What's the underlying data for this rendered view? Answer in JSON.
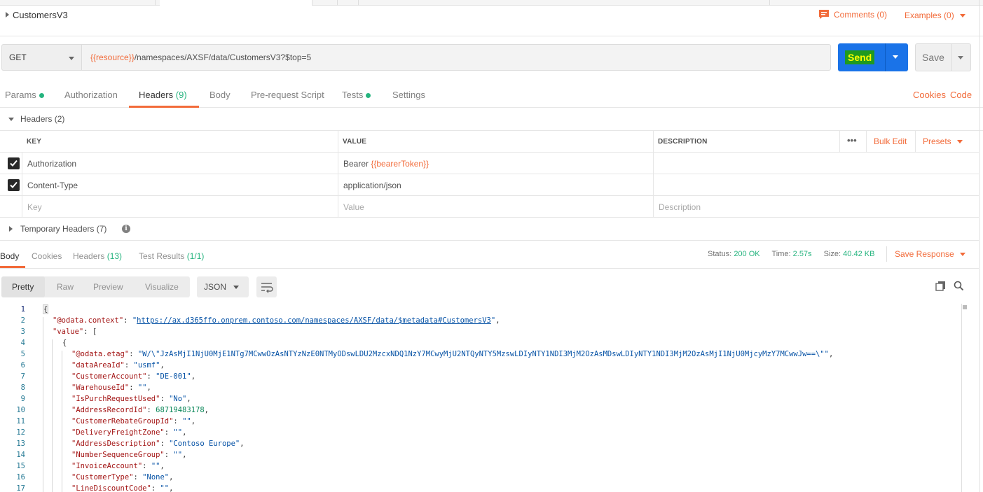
{
  "request": {
    "title": "CustomersV3",
    "comments": "Comments (0)",
    "examples": "Examples (0)",
    "method": "GET",
    "url_var": "{{resource}}",
    "url_rest": "/namespaces/AXSF/data/CustomersV3?$top=5",
    "send_label": "Send",
    "save_label": "Save"
  },
  "request_tabs": {
    "params": "Params",
    "authorization": "Authorization",
    "headers": "Headers",
    "headers_count": "(9)",
    "body": "Body",
    "prerequest": "Pre-request Script",
    "tests": "Tests",
    "settings": "Settings",
    "cookies": "Cookies",
    "code": "Code"
  },
  "headers_section": {
    "title": "Headers (2)",
    "columns": {
      "key": "KEY",
      "value": "VALUE",
      "description": "DESCRIPTION"
    },
    "more": "•••",
    "bulk_edit": "Bulk Edit",
    "presets": "Presets",
    "rows": [
      {
        "key": "Authorization",
        "value_prefix": "Bearer ",
        "value_var": "{{bearerToken}}"
      },
      {
        "key": "Content-Type",
        "value_prefix": "application/json",
        "value_var": ""
      }
    ],
    "placeholders": {
      "key": "Key",
      "value": "Value",
      "description": "Description"
    },
    "temporary": "Temporary Headers (7)"
  },
  "response_tabs": {
    "body": "Body",
    "cookies": "Cookies",
    "headers": "Headers",
    "headers_count": "(13)",
    "tests": "Test Results",
    "tests_count": "(1/1)"
  },
  "status": {
    "status_label": "Status:",
    "status_value": "200 OK",
    "time_label": "Time:",
    "time_value": "2.57s",
    "size_label": "Size:",
    "size_value": "40.42 KB",
    "save_response": "Save Response"
  },
  "format": {
    "pretty": "Pretty",
    "raw": "Raw",
    "preview": "Preview",
    "visualize": "Visualize",
    "selected": "JSON"
  },
  "code_lines": [
    {
      "n": "1",
      "t": "{"
    },
    {
      "n": "2",
      "k": "\"@odata.context\"",
      "u": "https://ax.d365ffo.onprem.contoso.com/namespaces/AXSF/data/$metadata#CustomersV3"
    },
    {
      "n": "3",
      "k": "\"value\"",
      "t": "["
    },
    {
      "n": "4",
      "t": "{"
    },
    {
      "n": "5",
      "k": "\"@odata.etag\"",
      "s": "\"W/\\\"JzAsMjI1NjU0MjE1NTg7MCwwOzAsNTYzNzE0NTMyODswLDU2MzcxNDQ1NzY7MCwyMjU2NTQyNTY5MzswLDIyNTY1NDI3MjM2OzAsMDswLDIyNTY1NDI3MjM2OzAsMjI1NjU0MjcyMzY7MCwwJw==\\\"\""
    },
    {
      "n": "6",
      "k": "\"dataAreaId\"",
      "s": "\"usmf\""
    },
    {
      "n": "7",
      "k": "\"CustomerAccount\"",
      "s": "\"DE-001\""
    },
    {
      "n": "8",
      "k": "\"WarehouseId\"",
      "s": "\"\""
    },
    {
      "n": "9",
      "k": "\"IsPurchRequestUsed\"",
      "s": "\"No\""
    },
    {
      "n": "10",
      "k": "\"AddressRecordId\"",
      "num": "68719483178"
    },
    {
      "n": "11",
      "k": "\"CustomerRebateGroupId\"",
      "s": "\"\""
    },
    {
      "n": "12",
      "k": "\"DeliveryFreightZone\"",
      "s": "\"\""
    },
    {
      "n": "13",
      "k": "\"AddressDescription\"",
      "s": "\"Contoso Europe\""
    },
    {
      "n": "14",
      "k": "\"NumberSequenceGroup\"",
      "s": "\"\""
    },
    {
      "n": "15",
      "k": "\"InvoiceAccount\"",
      "s": "\"\""
    },
    {
      "n": "16",
      "k": "\"CustomerType\"",
      "s": "\"None\""
    },
    {
      "n": "17",
      "k": "\"LineDiscountCode\"",
      "s": "\"\""
    }
  ]
}
